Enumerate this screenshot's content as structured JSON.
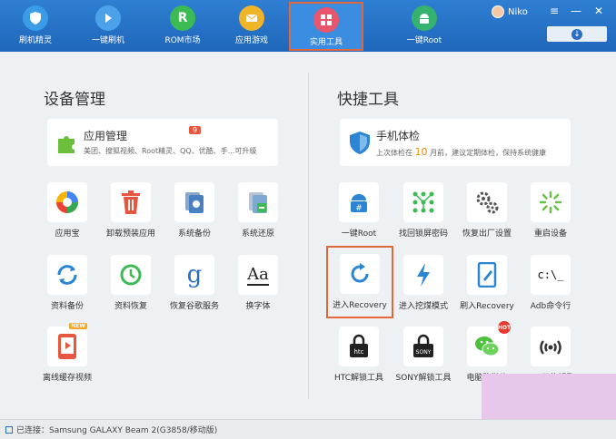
{
  "nav": [
    {
      "label": "刷机精灵",
      "icon": "shield-logo-icon",
      "color": "#3a9be6"
    },
    {
      "label": "一键刷机",
      "icon": "play-arrow-icon",
      "color": "#4aa3e8"
    },
    {
      "label": "ROM市场",
      "icon": "rom-r-icon",
      "color": "#3cba54"
    },
    {
      "label": "应用游戏",
      "icon": "envelope-icon",
      "color": "#f0b429"
    },
    {
      "label": "实用工具",
      "icon": "grid-tools-icon",
      "color": "#e8556d"
    },
    {
      "label": "一键Root",
      "icon": "android-icon",
      "color": "#35b36e"
    }
  ],
  "user": {
    "name": "Niko"
  },
  "left": {
    "title": "设备管理",
    "card": {
      "title": "应用管理",
      "badge": "9",
      "subtitle": "美团、搜狐视频、Root精灵、QQ、优酷、手...可升级"
    },
    "tools": [
      {
        "label": "应用宝",
        "icon": "yingyongbao-icon"
      },
      {
        "label": "卸载预装应用",
        "icon": "trash-icon"
      },
      {
        "label": "系统备份",
        "icon": "system-backup-icon"
      },
      {
        "label": "系统还原",
        "icon": "system-restore-icon"
      },
      {
        "label": "资料备份",
        "icon": "sync-icon"
      },
      {
        "label": "资料恢复",
        "icon": "history-icon"
      },
      {
        "label": "恢复谷歌服务",
        "icon": "google-g-icon",
        "glyph": "g"
      },
      {
        "label": "换字体",
        "icon": "font-icon",
        "glyph": "Aa"
      },
      {
        "label": "离线缓存视频",
        "icon": "video-phone-icon",
        "tag": "NEW"
      }
    ]
  },
  "right": {
    "title": "快捷工具",
    "card": {
      "title": "手机体检",
      "sub_prefix": "上次体检在",
      "sub_num": "10",
      "sub_suffix": "月前，建议定期体检，保持系统健康"
    },
    "tools": [
      {
        "label": "一键Root",
        "icon": "android-root-icon"
      },
      {
        "label": "找回锁屏密码",
        "icon": "pattern-lock-icon"
      },
      {
        "label": "恢复出厂设置",
        "icon": "gears-icon"
      },
      {
        "label": "重启设备",
        "icon": "reboot-spinner-icon"
      },
      {
        "label": "进入Recovery",
        "icon": "refresh-arrow-icon"
      },
      {
        "label": "进入挖煤模式",
        "icon": "lightning-icon"
      },
      {
        "label": "刷入Recovery",
        "icon": "phone-edit-icon"
      },
      {
        "label": "Adb命令行",
        "icon": "terminal-icon",
        "glyph": "c:\\_"
      },
      {
        "label": "HTC解锁工具",
        "icon": "htc-lock-icon",
        "glyph": "htc"
      },
      {
        "label": "SONY解锁工具",
        "icon": "sony-lock-icon",
        "glyph": "SONY"
      },
      {
        "label": "电脑聊微信",
        "icon": "wechat-icon",
        "tag": "HOT"
      },
      {
        "label": "Wifi万能钥匙",
        "icon": "wifi-key-icon"
      }
    ]
  },
  "status": {
    "text": "已连接：Samsung GALAXY Beam 2(G3858/移动版)"
  }
}
